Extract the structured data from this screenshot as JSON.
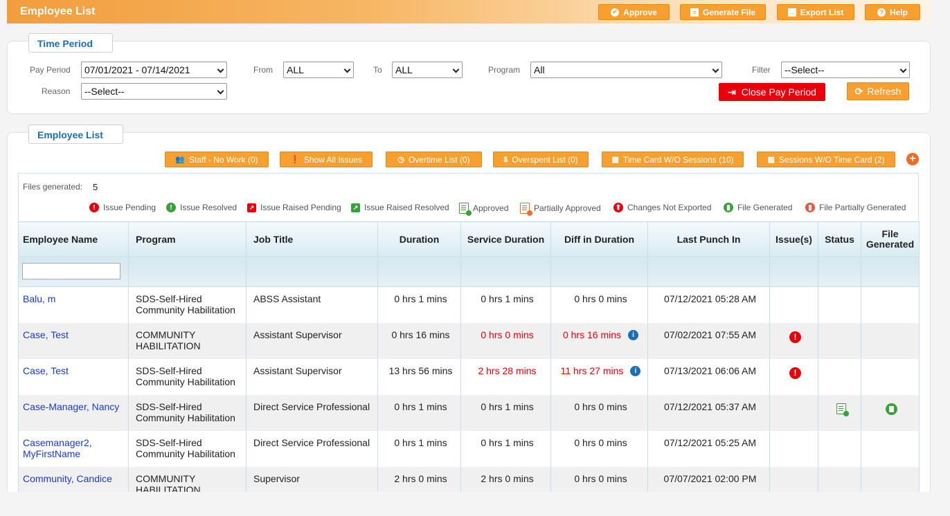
{
  "header": {
    "title": "Employee List",
    "buttons": {
      "approve": "Approve",
      "generate_file": "Generate File",
      "export_list": "Export List",
      "help": "Help"
    }
  },
  "time_period": {
    "tab_label": "Time Period",
    "pay_period_label": "Pay Period",
    "pay_period_value": "07/01/2021 - 07/14/2021",
    "from_label": "From",
    "from_value": "ALL",
    "to_label": "To",
    "to_value": "ALL",
    "program_label": "Program",
    "program_value": "All",
    "filter_label": "Filter",
    "filter_value": "--Select--",
    "reason_label": "Reason",
    "reason_value": "--Select--",
    "close_pay_period": "Close Pay Period",
    "refresh": "Refresh"
  },
  "employee_list": {
    "tab_label": "Employee List",
    "actions": {
      "staff_no_work": "Staff - No Work (0)",
      "show_all_issues": "Show All Issues",
      "overtime_list": "Overtime List (0)",
      "overspent_list": "Overspent List (0)",
      "time_card_wo_sessions": "Time Card W/O Sessions (10)",
      "sessions_wo_time_card": "Sessions W/O Time Card (2)"
    },
    "files_generated_label": "Files generated:",
    "files_generated_value": "5",
    "legend": {
      "issue_pending": "Issue Pending",
      "issue_resolved": "Issue Resolved",
      "issue_raised_pending": "Issue Raised Pending",
      "issue_raised_resolved": "Issue Raised Resolved",
      "approved": "Approved",
      "partially_approved": "Partially Approved",
      "changes_not_exported": "Changes Not Exported",
      "file_generated": "File Generated",
      "file_partially_generated": "File Partially Generated"
    },
    "columns": {
      "employee_name": "Employee Name",
      "program": "Program",
      "job_title": "Job Title",
      "duration": "Duration",
      "service_duration": "Service Duration",
      "diff_in_duration": "Diff in Duration",
      "last_punch_in": "Last Punch In",
      "issues": "Issue(s)",
      "status": "Status",
      "file_generated": "File Generated"
    },
    "rows": [
      {
        "name": "Balu, m",
        "program": "SDS-Self-Hired Community Habilitation",
        "job_title": "ABSS Assistant",
        "duration": "0 hrs 1 mins",
        "service_duration": "0 hrs 1 mins",
        "diff": "0 hrs 0 mins",
        "last_punch": "07/12/2021 05:28 AM"
      },
      {
        "name": "Case, Test",
        "program": "COMMUNITY HABILITATION",
        "job_title": "Assistant Supervisor",
        "duration": "0 hrs 16 mins",
        "service_duration": "0 hrs 0 mins",
        "diff": "0 hrs 16 mins",
        "last_punch": "07/02/2021 07:55 AM"
      },
      {
        "name": "Case, Test",
        "program": "SDS-Self-Hired Community Habilitation",
        "job_title": "Assistant Supervisor",
        "duration": "13 hrs 56 mins",
        "service_duration": "2 hrs 28 mins",
        "diff": "11 hrs 27 mins",
        "last_punch": "07/13/2021 06:06 AM"
      },
      {
        "name": "Case-Manager, Nancy",
        "program": "SDS-Self-Hired Community Habilitation",
        "job_title": "Direct Service Professional",
        "duration": "0 hrs 1 mins",
        "service_duration": "0 hrs 1 mins",
        "diff": "0 hrs 0 mins",
        "last_punch": "07/12/2021 05:37 AM"
      },
      {
        "name": "Casemanager2, MyFirstName",
        "program": "SDS-Self-Hired Community Habilitation",
        "job_title": "Direct Service Professional",
        "duration": "0 hrs 1 mins",
        "service_duration": "0 hrs 1 mins",
        "diff": "0 hrs 0 mins",
        "last_punch": "07/12/2021 05:25 AM"
      },
      {
        "name": "Community, Candice",
        "program": "COMMUNITY HABILITATION",
        "job_title": "Supervisor",
        "duration": "2 hrs 0 mins",
        "service_duration": "2 hrs 0 mins",
        "diff": "0 hrs 0 mins",
        "last_punch": "07/07/2021 02:00 PM"
      }
    ]
  }
}
